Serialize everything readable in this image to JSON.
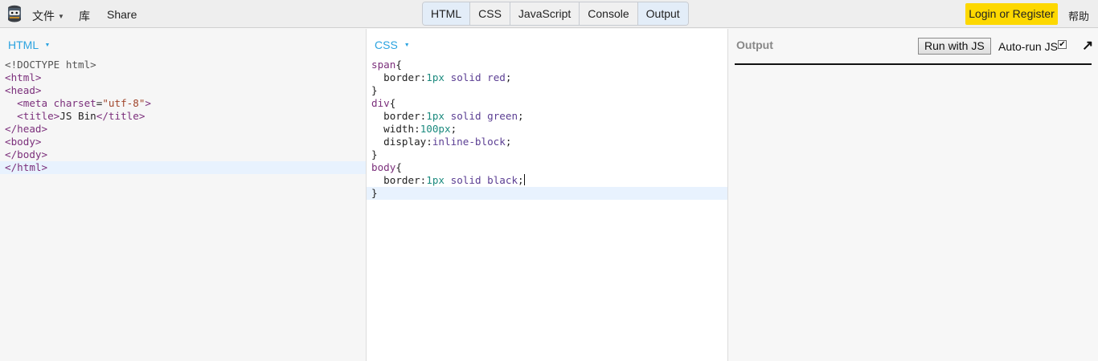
{
  "topbar": {
    "menu": [
      {
        "label": "文件",
        "dropdown": true
      },
      {
        "label": "库"
      },
      {
        "label": "Share"
      }
    ],
    "tabs": [
      {
        "label": "HTML",
        "active": true
      },
      {
        "label": "CSS",
        "active": false
      },
      {
        "label": "JavaScript",
        "active": false
      },
      {
        "label": "Console",
        "active": false
      },
      {
        "label": "Output",
        "active": true
      }
    ],
    "login_label": "Login or Register",
    "help_label": "帮助",
    "accent_color": "#fdd800"
  },
  "html_panel": {
    "label": "HTML",
    "lines": [
      [
        {
          "t": "doc",
          "v": "<!DOCTYPE html>"
        }
      ],
      [
        {
          "t": "tag",
          "v": "<html>"
        }
      ],
      [
        {
          "t": "tag",
          "v": "<head>"
        }
      ],
      [
        {
          "t": "txt",
          "v": "  "
        },
        {
          "t": "tag",
          "v": "<meta "
        },
        {
          "t": "attr",
          "v": "charset"
        },
        {
          "t": "pun",
          "v": "="
        },
        {
          "t": "str",
          "v": "\"utf-8\""
        },
        {
          "t": "tag",
          "v": ">"
        }
      ],
      [
        {
          "t": "txt",
          "v": "  "
        },
        {
          "t": "tag",
          "v": "<title>"
        },
        {
          "t": "txt",
          "v": "JS Bin"
        },
        {
          "t": "tag",
          "v": "</title>"
        }
      ],
      [
        {
          "t": "tag",
          "v": "</head>"
        }
      ],
      [
        {
          "t": "tag",
          "v": "<body>"
        }
      ],
      [
        {
          "t": "tag",
          "v": "</body>"
        }
      ],
      [
        {
          "t": "tag",
          "v": "</html>"
        }
      ]
    ],
    "highlight_line": 8
  },
  "css_panel": {
    "label": "CSS",
    "lines": [
      [
        {
          "t": "sel",
          "v": "span"
        },
        {
          "t": "pun",
          "v": "{"
        }
      ],
      [
        {
          "t": "txt",
          "v": "  "
        },
        {
          "t": "prop",
          "v": "border"
        },
        {
          "t": "pun",
          "v": ":"
        },
        {
          "t": "num",
          "v": "1px"
        },
        {
          "t": "txt",
          "v": " "
        },
        {
          "t": "kw",
          "v": "solid"
        },
        {
          "t": "txt",
          "v": " "
        },
        {
          "t": "kw",
          "v": "red"
        },
        {
          "t": "pun",
          "v": ";"
        }
      ],
      [
        {
          "t": "pun",
          "v": "}"
        }
      ],
      [
        {
          "t": "sel",
          "v": "div"
        },
        {
          "t": "pun",
          "v": "{"
        }
      ],
      [
        {
          "t": "txt",
          "v": "  "
        },
        {
          "t": "prop",
          "v": "border"
        },
        {
          "t": "pun",
          "v": ":"
        },
        {
          "t": "num",
          "v": "1px"
        },
        {
          "t": "txt",
          "v": " "
        },
        {
          "t": "kw",
          "v": "solid"
        },
        {
          "t": "txt",
          "v": " "
        },
        {
          "t": "kw",
          "v": "green"
        },
        {
          "t": "pun",
          "v": ";"
        }
      ],
      [
        {
          "t": "txt",
          "v": "  "
        },
        {
          "t": "prop",
          "v": "width"
        },
        {
          "t": "pun",
          "v": ":"
        },
        {
          "t": "num",
          "v": "100px"
        },
        {
          "t": "pun",
          "v": ";"
        }
      ],
      [
        {
          "t": "txt",
          "v": "  "
        },
        {
          "t": "prop",
          "v": "display"
        },
        {
          "t": "pun",
          "v": ":"
        },
        {
          "t": "kw",
          "v": "inline-block"
        },
        {
          "t": "pun",
          "v": ";"
        }
      ],
      [
        {
          "t": "pun",
          "v": "}"
        }
      ],
      [
        {
          "t": "sel",
          "v": "body"
        },
        {
          "t": "pun",
          "v": "{"
        }
      ],
      [
        {
          "t": "txt",
          "v": "  "
        },
        {
          "t": "prop",
          "v": "border"
        },
        {
          "t": "pun",
          "v": ":"
        },
        {
          "t": "num",
          "v": "1px"
        },
        {
          "t": "txt",
          "v": " "
        },
        {
          "t": "kw",
          "v": "solid"
        },
        {
          "t": "txt",
          "v": " "
        },
        {
          "t": "kw",
          "v": "black"
        },
        {
          "t": "pun",
          "v": ";"
        },
        {
          "t": "cursor",
          "v": ""
        }
      ],
      [
        {
          "t": "pun",
          "v": "}"
        }
      ]
    ],
    "highlight_line": 10
  },
  "output_panel": {
    "label": "Output",
    "run_label": "Run with JS",
    "autorun_label": "Auto-run JS",
    "autorun_checked": true,
    "checkmark": "✔",
    "popout_icon": "↗"
  }
}
